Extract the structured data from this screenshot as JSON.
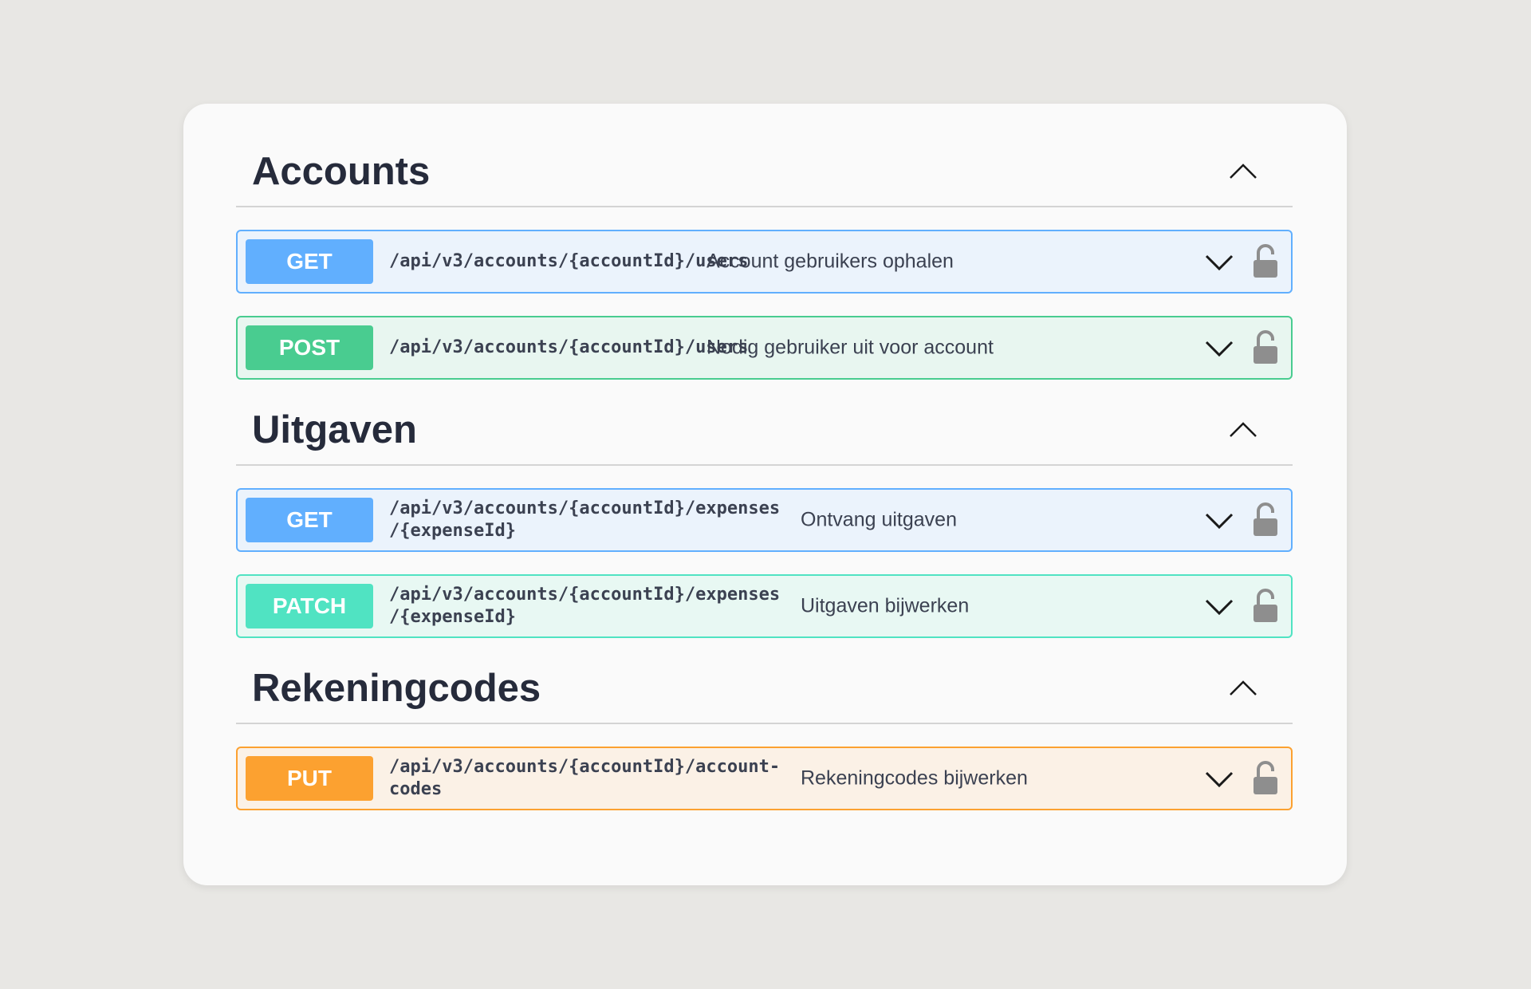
{
  "sections": [
    {
      "title": "Accounts",
      "toggle_icon": "chevron-up-icon",
      "operations": [
        {
          "method": "GET",
          "path": "/api/v3/accounts/{accountId}/users",
          "summary": "Account gebruikers ophalen"
        },
        {
          "method": "POST",
          "path": "/api/v3/accounts/{accountId}/users",
          "summary": "Nodig gebruiker uit voor account"
        }
      ]
    },
    {
      "title": "Uitgaven",
      "toggle_icon": "chevron-up-icon",
      "operations": [
        {
          "method": "GET",
          "path_line1": "/api/v3/accounts/{accountId}/expenses",
          "path_line2": "/{expenseId}",
          "summary": "Ontvang uitgaven"
        },
        {
          "method": "PATCH",
          "path_line1": "/api/v3/accounts/{accountId}/expenses",
          "path_line2": "/{expenseId}",
          "summary": "Uitgaven bijwerken"
        }
      ]
    },
    {
      "title": "Rekeningcodes",
      "toggle_icon": "chevron-up-icon",
      "operations": [
        {
          "method": "PUT",
          "path_line1": "/api/v3/accounts/{accountId}/account-",
          "path_line2": "codes",
          "summary": "Rekeningcodes bijwerken"
        }
      ]
    }
  ],
  "icons": {
    "expand": "chevron-down-icon",
    "auth": "unlocked-padlock-icon"
  },
  "colors": {
    "get": "#61affe",
    "post": "#49cc90",
    "patch": "#50e3c2",
    "put": "#fca130",
    "title": "#262b3b",
    "text": "#3b4151",
    "lock": "#8e8e8e"
  }
}
